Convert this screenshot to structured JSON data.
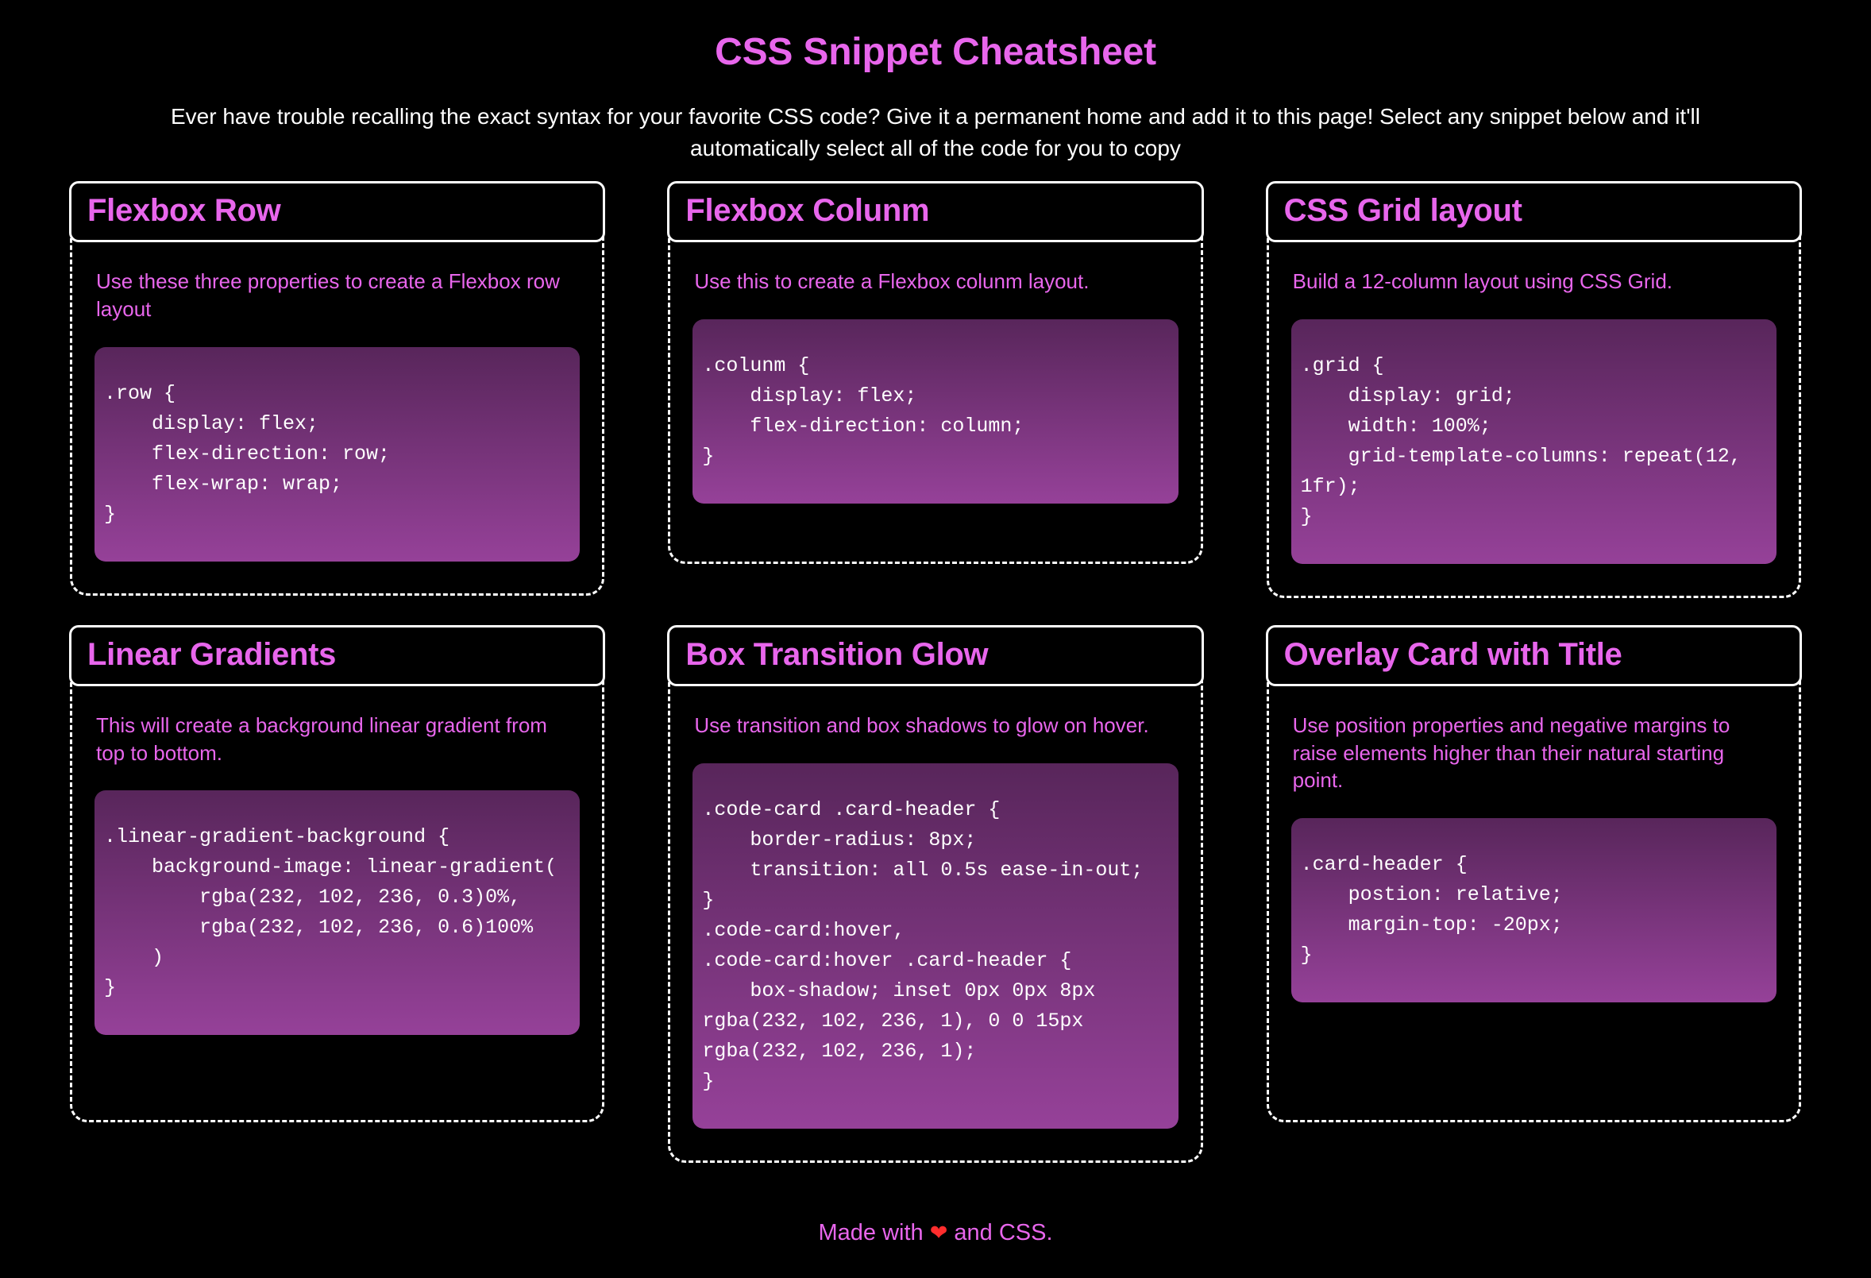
{
  "header": {
    "title": "CSS Snippet Cheatsheet",
    "subtitle": "Ever have trouble recalling the exact syntax for your favorite CSS code? Give it a permanent home and add it to this page! Select any snippet below and it'll automatically select all of the code for you to copy"
  },
  "colors": {
    "background": "#000000",
    "accent_pink": "#e866ec",
    "border_white": "#ffffff",
    "code_text": "#ffffff",
    "code_gradient_top": "rgba(232, 102, 236, 0.3)",
    "code_gradient_bottom": "rgba(232, 102, 236, 0.6)",
    "heart_red": "#ff2d2d"
  },
  "cards": [
    {
      "title": "Flexbox Row",
      "description": "Use these three properties to create a Flexbox row layout",
      "code": ".row {\n    display: flex;\n    flex-direction: row;\n    flex-wrap: wrap;\n}"
    },
    {
      "title": "Flexbox Colunm",
      "description": "Use this to create a Flexbox colunm layout.",
      "code": ".colunm {\n    display: flex;\n    flex-direction: column;\n}"
    },
    {
      "title": "CSS Grid layout",
      "description": "Build a 12-column layout using CSS Grid.",
      "code": ".grid {\n    display: grid;\n    width: 100%;\n    grid-template-columns: repeat(12, 1fr);\n}"
    },
    {
      "title": "Linear Gradients",
      "description": "This will create a background linear gradient from top to bottom.",
      "code": ".linear-gradient-background {\n    background-image: linear-gradient(\n        rgba(232, 102, 236, 0.3)0%,\n        rgba(232, 102, 236, 0.6)100%\n    )\n}"
    },
    {
      "title": "Box Transition Glow",
      "description": "Use transition and box shadows to glow on hover.",
      "code": ".code-card .card-header {\n    border-radius: 8px;\n    transition: all 0.5s ease-in-out;\n}\n.code-card:hover,\n.code-card:hover .card-header {\n    box-shadow; inset 0px 0px 8px rgba(232, 102, 236, 1), 0 0 15px rgba(232, 102, 236, 1);\n}"
    },
    {
      "title": "Overlay Card with Title",
      "description": "Use position properties and negative margins to raise elements higher than their natural starting point.",
      "code": ".card-header {\n    postion: relative;\n    margin-top: -20px;\n}"
    }
  ],
  "footer": {
    "text_before": "Made with ",
    "heart": "❤",
    "text_after": " and CSS."
  }
}
